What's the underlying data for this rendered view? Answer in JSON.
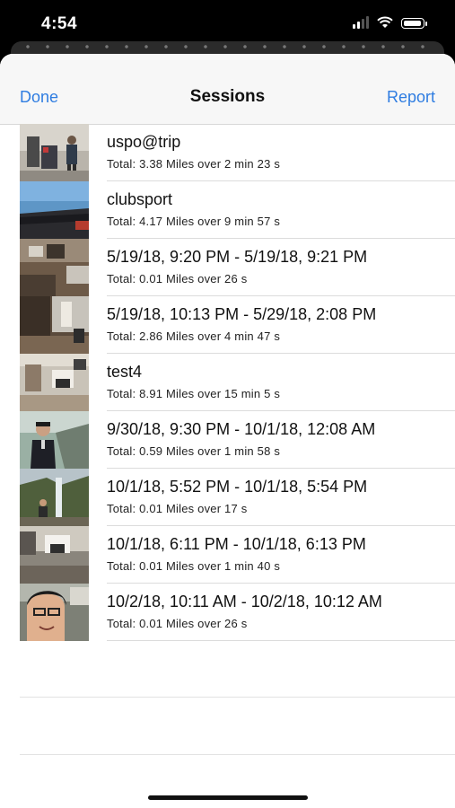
{
  "status": {
    "time": "4:54"
  },
  "nav": {
    "done_label": "Done",
    "title": "Sessions",
    "report_label": "Report"
  },
  "sessions": [
    {
      "title": "uspo@trip",
      "summary": "Total: 3.38 Miles over 2 min 23 s"
    },
    {
      "title": "clubsport",
      "summary": "Total: 4.17 Miles over 9 min 57 s"
    },
    {
      "title": "5/19/18, 9:20 PM - 5/19/18, 9:21 PM",
      "summary": "Total: 0.01 Miles over 26 s"
    },
    {
      "title": "5/19/18, 10:13 PM - 5/29/18, 2:08 PM",
      "summary": "Total: 2.86 Miles over 4 min 47 s"
    },
    {
      "title": "test4",
      "summary": "Total: 8.91 Miles over 15 min 5 s"
    },
    {
      "title": "9/30/18, 9:30 PM - 10/1/18, 12:08 AM",
      "summary": "Total: 0.59 Miles over 1 min 58 s"
    },
    {
      "title": "10/1/18, 5:52 PM - 10/1/18, 5:54 PM",
      "summary": "Total: 0.01 Miles over 17 s"
    },
    {
      "title": "10/1/18, 6:11 PM - 10/1/18, 6:13 PM",
      "summary": "Total: 0.01 Miles over 1 min 40 s"
    },
    {
      "title": "10/2/18, 10:11 AM - 10/2/18, 10:12 AM",
      "summary": "Total: 0.01 Miles over 26 s"
    }
  ]
}
